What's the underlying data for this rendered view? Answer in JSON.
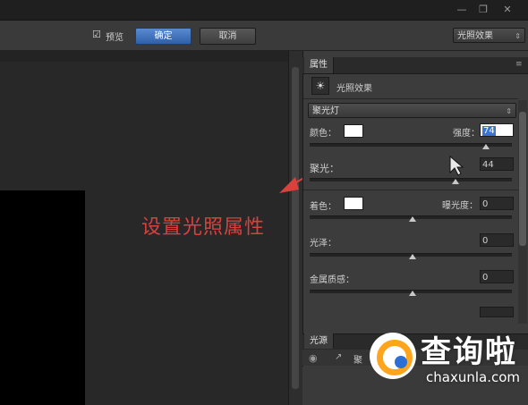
{
  "titlebar": {
    "minimize_icon": "minimize-icon",
    "restore_icon": "restore-icon",
    "close_icon": "close-icon"
  },
  "options": {
    "preview_label": "预览",
    "preview_checked": true,
    "ok_label": "确定",
    "cancel_label": "取消",
    "preset_value": "光照效果"
  },
  "panel": {
    "tab_label": "属性",
    "heading": "光照效果",
    "light_type": "聚光灯",
    "color_label": "颜色：",
    "intensity_label": "强度：",
    "intensity_value": "74",
    "hotspot_label": "聚光：",
    "hotspot_value": "44",
    "tint_label": "着色：",
    "exposure_label": "曝光度：",
    "exposure_value": "0",
    "gloss_label": "光泽：",
    "gloss_value": "0",
    "metallic_label": "金属质感：",
    "metallic_value": "0",
    "light_color": "#ffffff",
    "tint_color": "#ffffff"
  },
  "light_source": {
    "header_label": "光源",
    "row_label": "聚"
  },
  "annotation": {
    "text": "设置光照属性",
    "color": "#d9413d"
  },
  "watermark": {
    "brand": "查询啦",
    "url": "chaxunla.com"
  }
}
